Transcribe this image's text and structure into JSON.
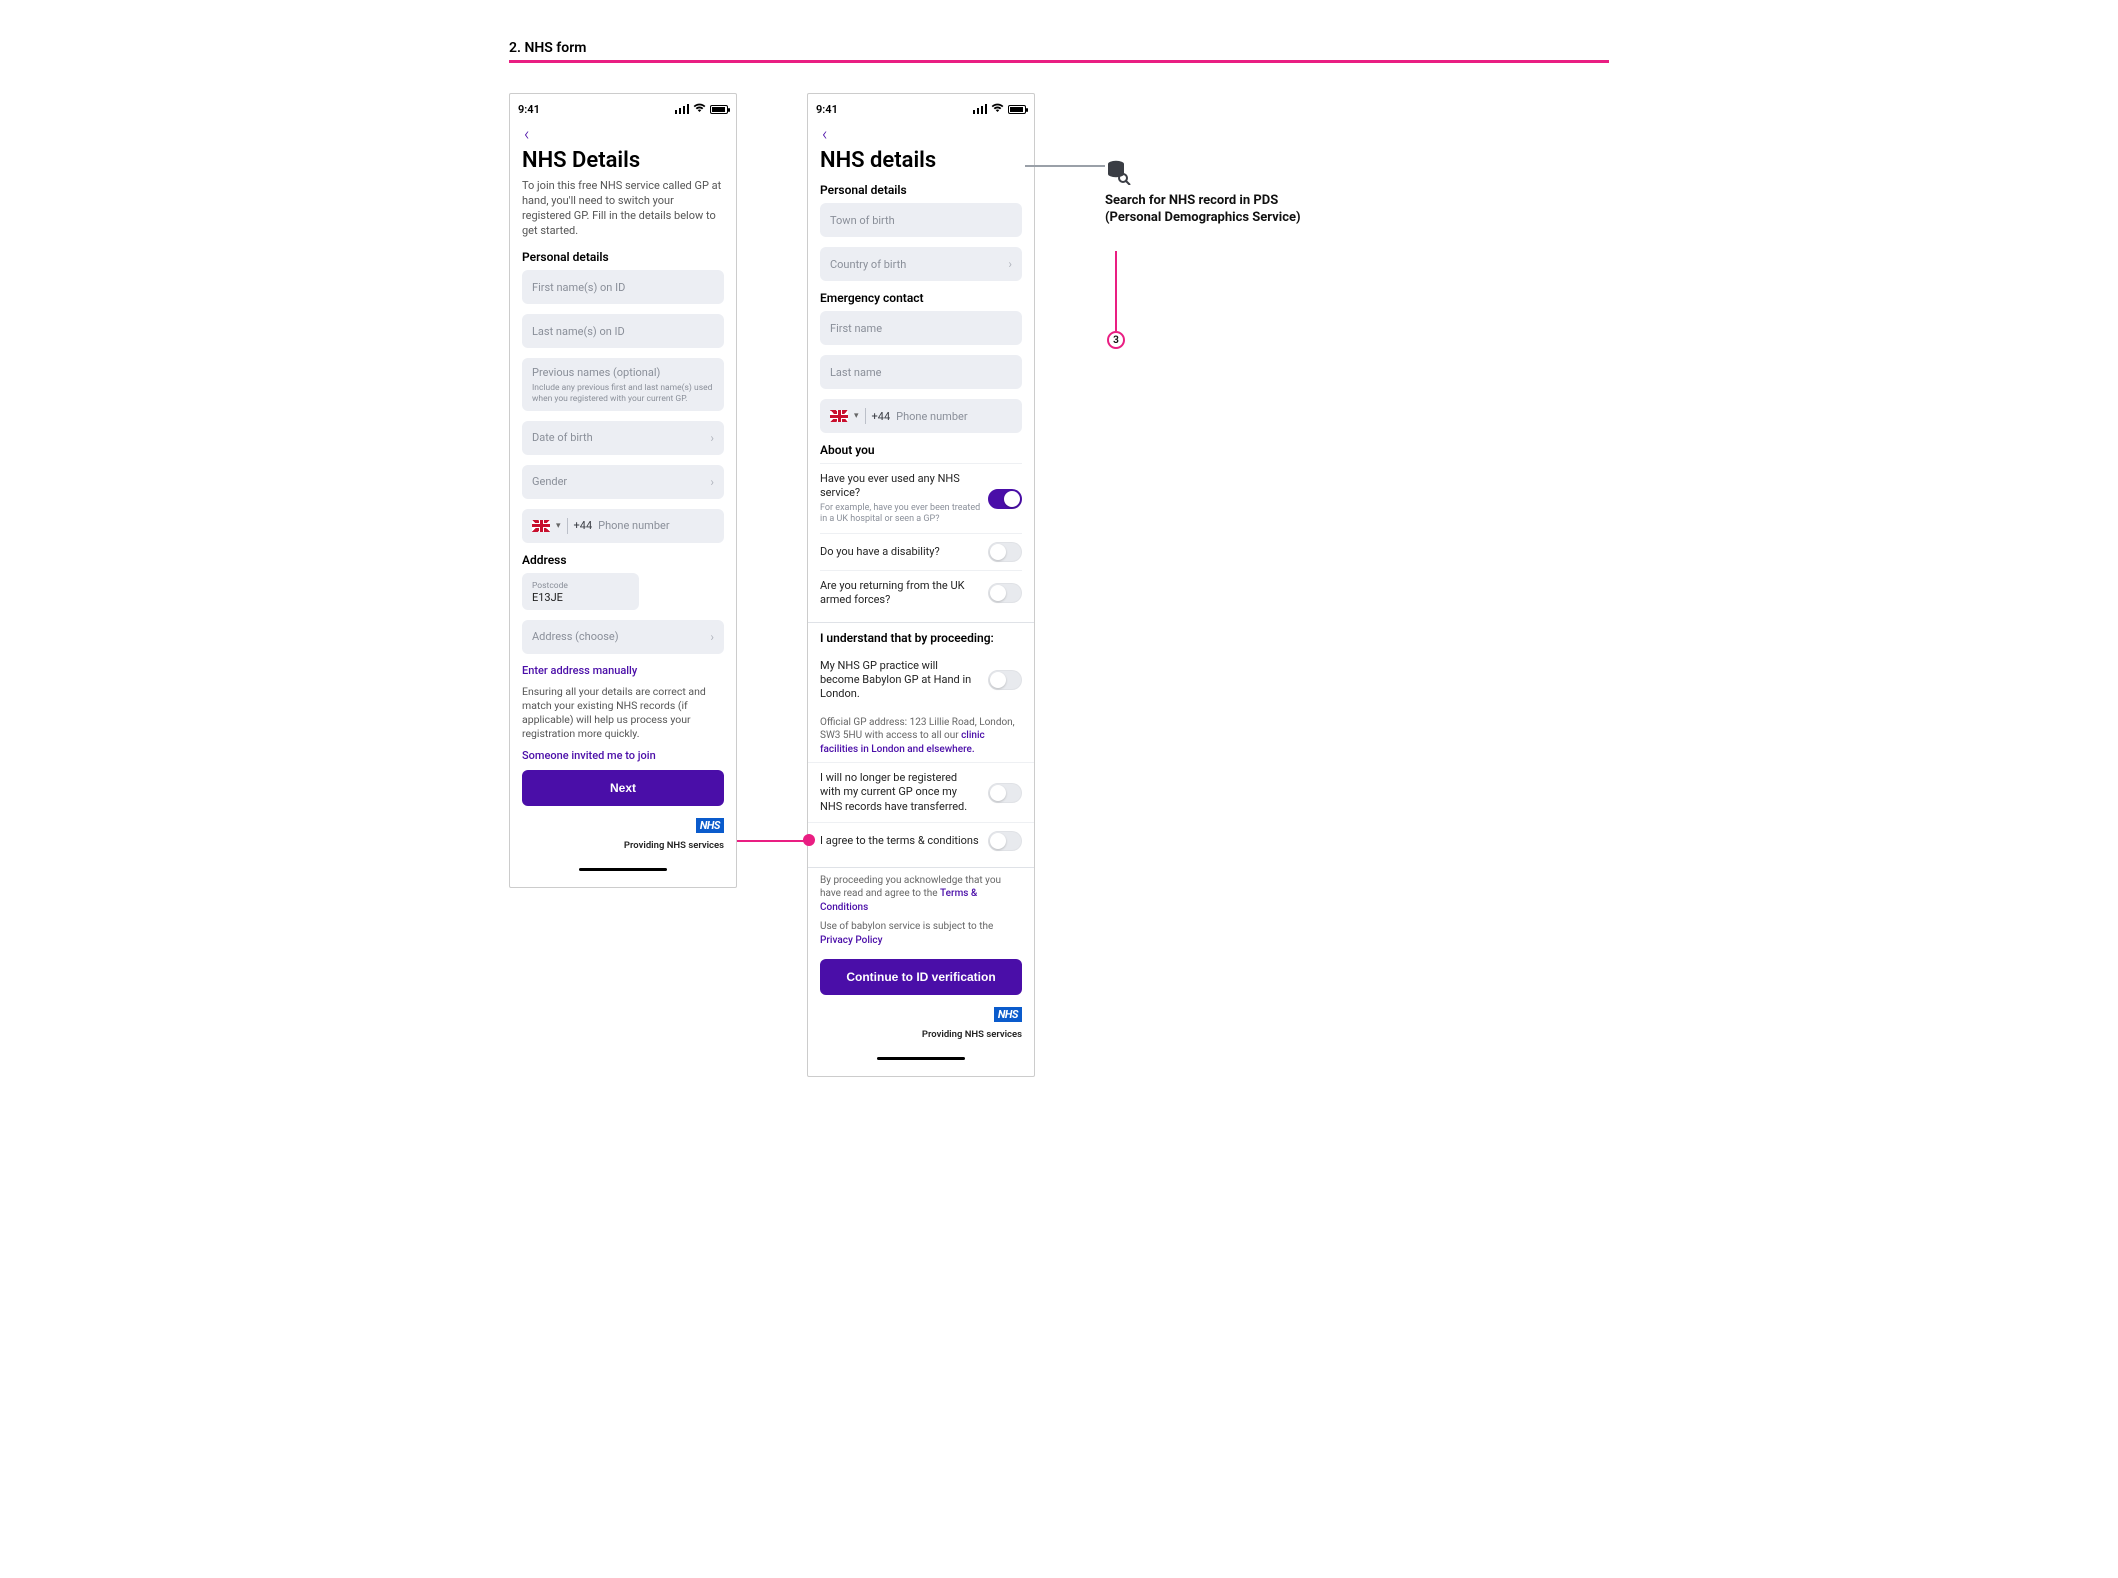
{
  "header": {
    "title": "2. NHS form"
  },
  "status": {
    "time": "9:41"
  },
  "screen1": {
    "title": "NHS Details",
    "intro": "To join this free NHS service called GP at hand, you'll need to switch your registered GP. Fill in the details below to get started.",
    "personal_head": "Personal details",
    "first_name_ph": "First name(s) on ID",
    "last_name_ph": "Last name(s) on ID",
    "prev_names_ph": "Previous names (optional)",
    "prev_names_help": "Include any previous first and last name(s) used when you registered with your current GP.",
    "dob_ph": "Date of birth",
    "gender_ph": "Gender",
    "cc": "+44",
    "phone_ph": "Phone number",
    "address_head": "Address",
    "postcode_label": "Postcode",
    "postcode_value": "E13JE",
    "address_choose_ph": "Address (choose)",
    "enter_manually": "Enter address manually",
    "ensure_note": "Ensuring all your details are correct and match your existing NHS records (if applicable) will help us process your registration more quickly.",
    "invited": "Someone invited me to join",
    "next": "Next",
    "nhs": "NHS",
    "providing": "Providing NHS services"
  },
  "screen2": {
    "title": "NHS details",
    "personal_head": "Personal details",
    "town_ph": "Town of birth",
    "country_ph": "Country of birth",
    "emergency_head": "Emergency contact",
    "efirst_ph": "First name",
    "elast_ph": "Last name",
    "cc": "+44",
    "phone_ph": "Phone number",
    "about_head": "About you",
    "q_used": "Have you ever used any NHS service?",
    "q_used_sub": "For example, have you ever been treated in a UK hospital or seen a GP?",
    "q_disability": "Do you have a disability?",
    "q_armed": "Are you returning from the UK armed forces?",
    "consent_head": "I understand that by proceeding:",
    "c1": "My NHS GP practice will become Babylon GP at Hand in London.",
    "c1_sub_a": "Official GP address: 123 Lillie Road, London, SW3 5HU with access to all our ",
    "c1_sub_link": "clinic facilities in London and elsewhere.",
    "c2": "I will no longer be registered with my current GP once my NHS records have transferred.",
    "c3": "I agree to the terms & conditions",
    "ack_a": "By proceeding you acknowledge that you have read and agree to the ",
    "ack_link": "Terms & Conditions",
    "use_a": "Use of babylon service is subject to the ",
    "use_link": "Privacy Policy",
    "continue": "Continue to ID verification",
    "nhs": "NHS",
    "providing": "Providing NHS services"
  },
  "annotation": {
    "text": "Search for NHS record in PDS (Personal Demographics Service)",
    "badge": "3"
  }
}
